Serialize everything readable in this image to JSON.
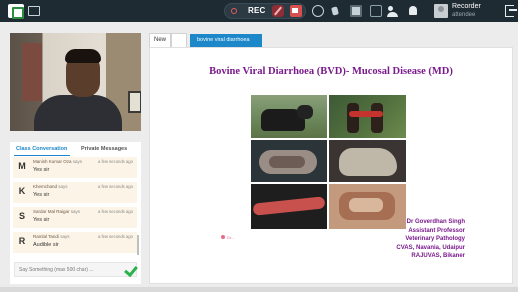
{
  "topbar": {
    "rec_label": "REC",
    "recorder_name": "Recorder",
    "recorder_role": "attendee",
    "icons": [
      "screen-share-icon",
      "mic-off-icon",
      "camera-icon",
      "power-icon",
      "raise-hand-icon",
      "layout-icon",
      "chat-icon",
      "participants-icon",
      "bell-icon",
      "avatar-icon",
      "exit-icon"
    ]
  },
  "chat": {
    "tabs": {
      "class": "Class Conversation",
      "private": "Private Messages"
    },
    "messages": [
      {
        "initial": "M",
        "name": "Manish Kumar Oza",
        "verb": "says",
        "time": "a few seconds ago",
        "text": "Yes sir"
      },
      {
        "initial": "K",
        "name": "Khemchand",
        "verb": "says",
        "time": "a few seconds ago",
        "text": "Yes sir"
      },
      {
        "initial": "S",
        "name": "Sardar Mal Raigar",
        "verb": "says",
        "time": "a few seconds ago",
        "text": "Yes sir"
      },
      {
        "initial": "R",
        "name": "Ramlal Tandi",
        "verb": "says",
        "time": "a few seconds ago",
        "text": "Audible sir"
      }
    ],
    "input_placeholder": "Say Something (max 500 char) ..."
  },
  "doc_tabs": {
    "new": "New",
    "active": "bovine viral diarrhoea"
  },
  "slide": {
    "title": "Bovine Viral Diarrhoea (BVD)- Mucosal Disease (MD)",
    "pointer_label": "Dr...",
    "credits": [
      "Dr Goverdhan Singh",
      "Assistant Professor",
      "Veterinary Pathology",
      "CVAS, Navania, Udaipur",
      "RAJUVAS, Bikaner"
    ]
  },
  "colors": {
    "topbar": "#1f2b33",
    "accent": "#1c87c9",
    "slide_title": "#7a1a8c",
    "message_bg": "#fcf4e6"
  }
}
